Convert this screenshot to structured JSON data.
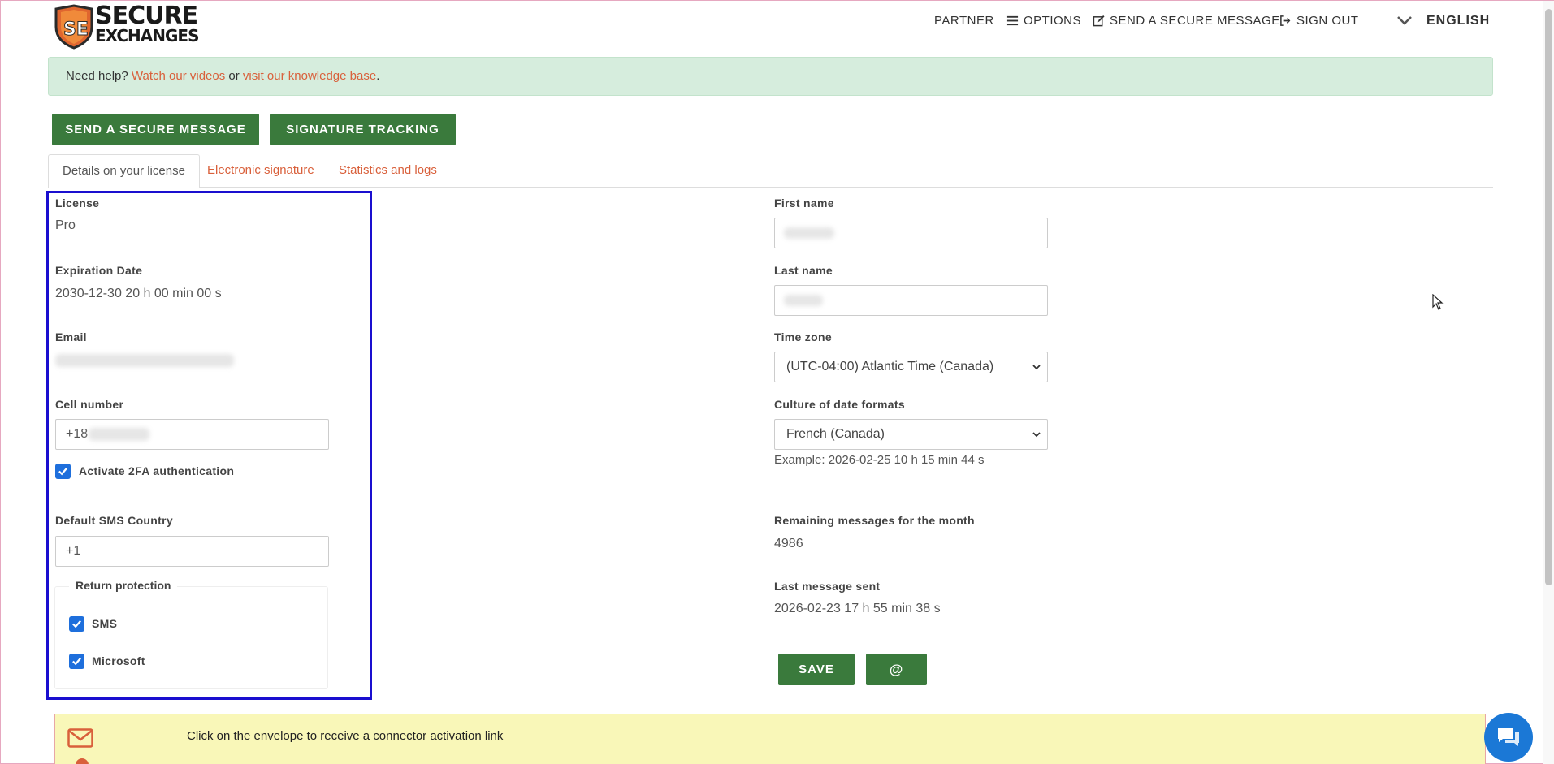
{
  "header": {
    "logo": {
      "line1": "SECURE",
      "line2": "EXCHANGES"
    },
    "nav": {
      "partner": "PARTNER",
      "options": "OPTIONS",
      "send": "SEND A SECURE MESSAGE",
      "signout": "SIGN OUT",
      "language": "ENGLISH"
    }
  },
  "help": {
    "prefix": "Need help?",
    "videos_link": "Watch our videos",
    "or": "or",
    "kb_link": "visit our knowledge base",
    "suffix": "."
  },
  "actions": {
    "send_button": "SEND A SECURE MESSAGE",
    "signature_button": "SIGNATURE TRACKING"
  },
  "tabs": [
    {
      "label": "Details on your license",
      "active": true
    },
    {
      "label": "Electronic signature",
      "active": false
    },
    {
      "label": "Statistics and logs",
      "active": false
    }
  ],
  "left": {
    "license_label": "License",
    "license_value": "Pro",
    "expiration_label": "Expiration Date",
    "expiration_value": "2030-12-30 20 h 00 min 00 s",
    "email_label": "Email",
    "cell_label": "Cell number",
    "cell_value": "+18",
    "twofa_label": "Activate 2FA authentication",
    "twofa_checked": true,
    "sms_country_label": "Default SMS Country",
    "sms_country_value": "+1",
    "return_protection_legend": "Return protection",
    "return_sms_label": "SMS",
    "return_microsoft_label": "Microsoft"
  },
  "right": {
    "first_name_label": "First name",
    "last_name_label": "Last name",
    "timezone_label": "Time zone",
    "timezone_value": "(UTC-04:00) Atlantic Time (Canada)",
    "culture_label": "Culture of date formats",
    "culture_value": "French (Canada)",
    "culture_example": "Example: 2026-02-25 10 h 15 min 44 s",
    "remaining_label": "Remaining messages for the month",
    "remaining_value": "4986",
    "last_sent_label": "Last message sent",
    "last_sent_value": "2026-02-23 17 h 55 min 38 s",
    "save_button": "SAVE",
    "at_button": "@"
  },
  "notice": {
    "text": "Click on the envelope to receive a connector activation link"
  },
  "colors": {
    "green": "#3a7a3c",
    "link": "#d9603b",
    "highlight": "#1a0fcf",
    "checkbox": "#1e6fdc",
    "help_bg": "#d6eddd",
    "notice_bg": "#f9f7b8"
  }
}
